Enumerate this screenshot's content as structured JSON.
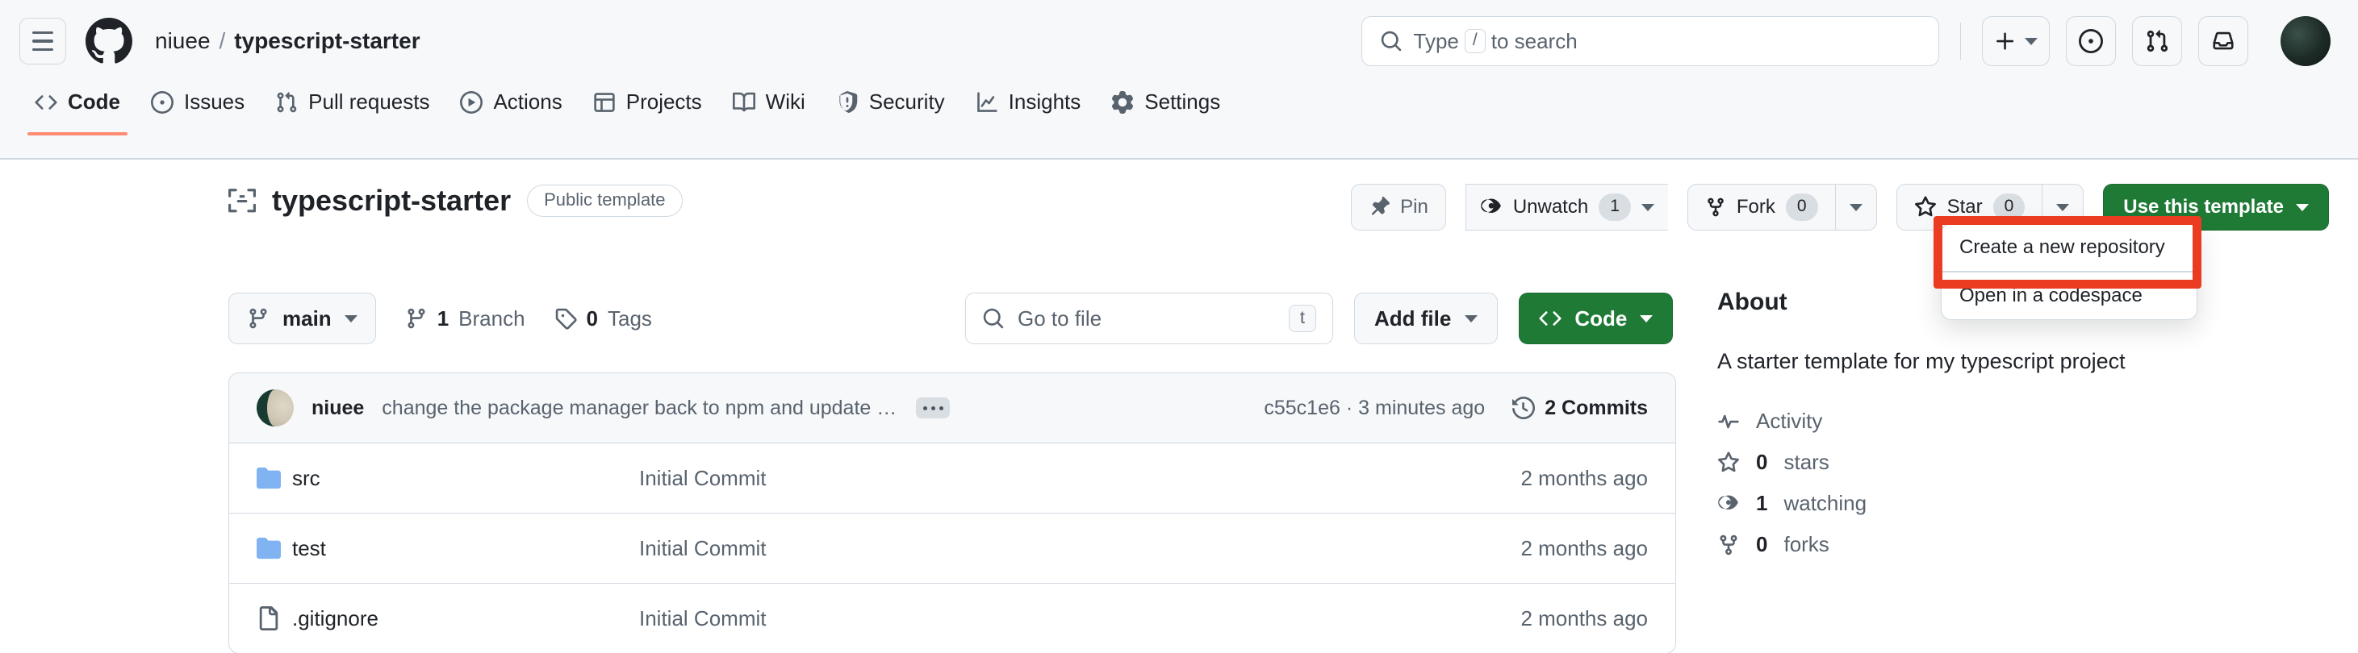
{
  "header": {
    "menu_label": "Open menu",
    "logo": "github-logo",
    "owner": "niuee",
    "separator": "/",
    "repo": "typescript-starter",
    "search": {
      "placeholder_before": "Type",
      "key": "/",
      "placeholder_after": "to search"
    },
    "actions": [
      {
        "name": "create-new-button",
        "icon": "plus-icon",
        "has_caret": true
      },
      {
        "name": "issues-button",
        "icon": "issue-opened-icon",
        "has_caret": false
      },
      {
        "name": "pull-requests-button",
        "icon": "git-pull-request-icon",
        "has_caret": false
      },
      {
        "name": "notifications-button",
        "icon": "inbox-icon",
        "has_caret": false
      }
    ],
    "avatar": "user-avatar"
  },
  "nav_tabs": [
    {
      "label": "Code",
      "icon": "code-icon",
      "active": true
    },
    {
      "label": "Issues",
      "icon": "issue-opened-icon",
      "active": false
    },
    {
      "label": "Pull requests",
      "icon": "git-pull-request-icon",
      "active": false
    },
    {
      "label": "Actions",
      "icon": "play-icon",
      "active": false
    },
    {
      "label": "Projects",
      "icon": "table-icon",
      "active": false
    },
    {
      "label": "Wiki",
      "icon": "book-icon",
      "active": false
    },
    {
      "label": "Security",
      "icon": "shield-icon",
      "active": false
    },
    {
      "label": "Insights",
      "icon": "graph-icon",
      "active": false
    },
    {
      "label": "Settings",
      "icon": "gear-icon",
      "active": false
    }
  ],
  "repo_header": {
    "icon": "repo-template-icon",
    "name": "typescript-starter",
    "visibility_badge": "Public template",
    "pin_label": "Pin",
    "watch_label": "Unwatch",
    "watch_count": "1",
    "fork_label": "Fork",
    "fork_count": "0",
    "star_label": "Star",
    "star_count": "0",
    "use_template_label": "Use this template"
  },
  "use_template_menu": {
    "items": [
      {
        "label": "Create a new repository",
        "highlighted": true
      },
      {
        "label": "Open in a codespace",
        "highlighted": false
      }
    ],
    "highlight_color": "#eb3b21"
  },
  "toolbar": {
    "branch": "main",
    "branch_count": "1",
    "branch_word": "Branch",
    "tag_count": "0",
    "tag_word": "Tags",
    "go_to_file_placeholder": "Go to file",
    "go_to_file_key": "t",
    "add_file_label": "Add file",
    "code_label": "Code"
  },
  "latest_commit": {
    "author": "niuee",
    "message": "change the package manager back to npm and update vulnerable dependen…",
    "sha": "c55c1e6",
    "separator": "·",
    "time": "3 minutes ago",
    "commits_count": "2 Commits"
  },
  "files": [
    {
      "name": "src",
      "type": "folder",
      "commit": "Initial Commit",
      "time": "2 months ago"
    },
    {
      "name": "test",
      "type": "folder",
      "commit": "Initial Commit",
      "time": "2 months ago"
    },
    {
      "name": ".gitignore",
      "type": "file",
      "commit": "Initial Commit",
      "time": "2 months ago"
    }
  ],
  "about": {
    "heading": "About",
    "description": "A starter template for my typescript project",
    "links": [
      {
        "label": "Activity",
        "icon": "pulse-icon",
        "bold": ""
      },
      {
        "label": "stars",
        "icon": "star-icon",
        "bold": "0"
      },
      {
        "label": "watching",
        "icon": "eye-icon",
        "bold": "1"
      },
      {
        "label": "forks",
        "icon": "repo-forked-icon",
        "bold": "0"
      }
    ]
  },
  "colors": {
    "accent_green": "#1f7a36",
    "highlight_red": "#eb3b21",
    "active_tab_underline": "#fd8c73",
    "folder_blue": "#7FB3F2",
    "header_bg": "#f6f8fa",
    "border": "#d1d9e0"
  }
}
